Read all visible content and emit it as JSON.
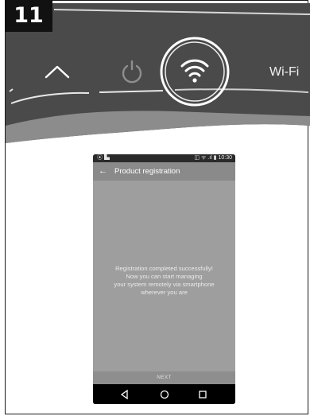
{
  "step_number": "11",
  "control_panel": {
    "wifi_label": "Wi-Fi",
    "icons": [
      "chevron-up-icon",
      "power-icon",
      "wifi-icon"
    ]
  },
  "phone": {
    "status_bar": {
      "left": "⦿ ▙",
      "right": "◫ ᯤ .ıl ▮ 10:30"
    },
    "app_bar": {
      "back_icon": "←",
      "title": "Product registration"
    },
    "message": {
      "line1": "Registration completed successfully!",
      "line2": "Now you can start managing",
      "line3": "your system remotely via smartphone",
      "line4": "wherever you are"
    },
    "next_label": "NEXT",
    "nav_icons": [
      "back-triangle-icon",
      "home-circle-icon",
      "recents-square-icon"
    ]
  }
}
